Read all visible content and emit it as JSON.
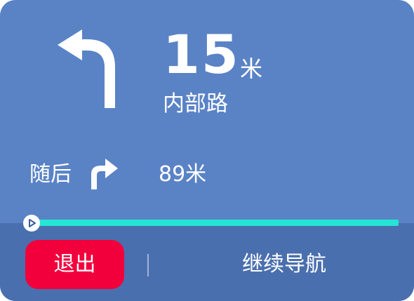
{
  "maneuver": {
    "icon": "turn-left-arrow-icon",
    "distance_value": "15",
    "distance_unit": "米",
    "road_name": "内部路"
  },
  "next_maneuver": {
    "label": "随后",
    "icon": "turn-right-arrow-icon",
    "distance": "89米"
  },
  "progress": {
    "fraction": 0.0
  },
  "actions": {
    "exit_label": "退出",
    "continue_label": "继续导航"
  },
  "colors": {
    "card_bg": "#5a83c6",
    "bottom_bar_bg": "#4a6fae",
    "progress": "#25e6d4",
    "exit_button": "#f2003c",
    "text": "#ffffff"
  }
}
